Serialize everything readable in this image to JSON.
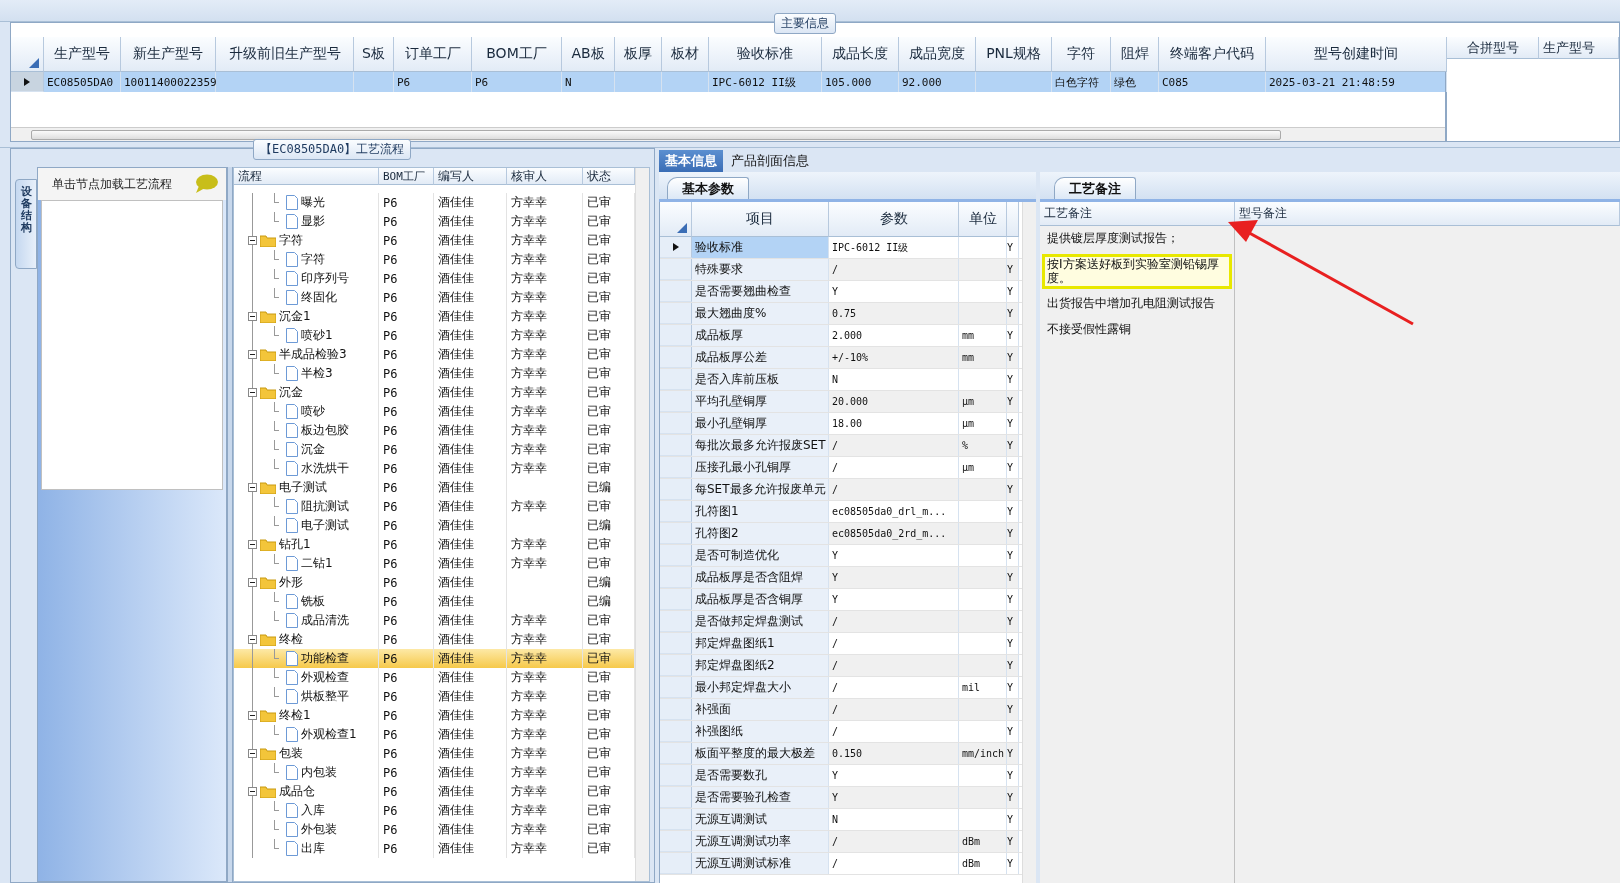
{
  "main_info": {
    "title": "主要信息",
    "columns": [
      "生产型号",
      "新生产型号",
      "升级前旧生产型号",
      "S板",
      "订单工厂",
      "BOM工厂",
      "AB板",
      "板厚",
      "板材",
      "验收标准",
      "成品长度",
      "成品宽度",
      "PNL规格",
      "字符",
      "阻焊",
      "终端客户代码",
      "型号创建时间"
    ],
    "rows": [
      {
        "selected": true,
        "cells": [
          "EC08505DA0",
          "10011400022359",
          null,
          null,
          "P6",
          "P6",
          "N",
          null,
          null,
          "IPC-6012 II级",
          "105.000",
          "92.000",
          null,
          "白色字符",
          "绿色",
          "C085",
          "2025-03-21 21:48:59"
        ]
      }
    ]
  },
  "merge_grid": {
    "columns": [
      "合拼型号",
      "生产型号"
    ]
  },
  "process_flow": {
    "title": "【EC08505DA0】工艺流程",
    "side_tab": "设备结构",
    "hint": "单击节点加载工艺流程",
    "columns": [
      "流程",
      "BOM工厂",
      "编写人",
      "核审人",
      "状态"
    ],
    "tree": [
      {
        "children": [
          {
            "label": "曝光",
            "bom": "P6",
            "writer": "酒佳佳",
            "reviewer": "方幸幸",
            "status": "已审",
            "selected": false
          },
          {
            "label": "显影",
            "bom": "P6",
            "writer": "酒佳佳",
            "reviewer": "方幸幸",
            "status": "已审",
            "selected": false
          }
        ]
      },
      {
        "label": "字符",
        "bom": "P6",
        "writer": "酒佳佳",
        "reviewer": "方幸幸",
        "status": "已审",
        "expanded": true,
        "selected": false,
        "children": [
          {
            "label": "字符",
            "bom": "P6",
            "writer": "酒佳佳",
            "reviewer": "方幸幸",
            "status": "已审",
            "selected": false
          },
          {
            "label": "印序列号",
            "bom": "P6",
            "writer": "酒佳佳",
            "reviewer": "方幸幸",
            "status": "已审",
            "selected": false
          },
          {
            "label": "终固化",
            "bom": "P6",
            "writer": "酒佳佳",
            "reviewer": "方幸幸",
            "status": "已审",
            "selected": false
          }
        ]
      },
      {
        "label": "沉金1",
        "bom": "P6",
        "writer": "酒佳佳",
        "reviewer": "方幸幸",
        "status": "已审",
        "expanded": true,
        "selected": false,
        "children": [
          {
            "label": "喷砂1",
            "bom": "P6",
            "writer": "酒佳佳",
            "reviewer": "方幸幸",
            "status": "已审",
            "selected": false
          }
        ]
      },
      {
        "label": "半成品检验3",
        "bom": "P6",
        "writer": "酒佳佳",
        "reviewer": "方幸幸",
        "status": "已审",
        "expanded": true,
        "selected": false,
        "children": [
          {
            "label": "半检3",
            "bom": "P6",
            "writer": "酒佳佳",
            "reviewer": "方幸幸",
            "status": "已审",
            "selected": false
          }
        ]
      },
      {
        "label": "沉金",
        "bom": "P6",
        "writer": "酒佳佳",
        "reviewer": "方幸幸",
        "status": "已审",
        "expanded": true,
        "selected": false,
        "children": [
          {
            "label": "喷砂",
            "bom": "P6",
            "writer": "酒佳佳",
            "reviewer": "方幸幸",
            "status": "已审",
            "selected": false
          },
          {
            "label": "板边包胶",
            "bom": "P6",
            "writer": "酒佳佳",
            "reviewer": "方幸幸",
            "status": "已审",
            "selected": false
          },
          {
            "label": "沉金",
            "bom": "P6",
            "writer": "酒佳佳",
            "reviewer": "方幸幸",
            "status": "已审",
            "selected": false
          },
          {
            "label": "水洗烘干",
            "bom": "P6",
            "writer": "酒佳佳",
            "reviewer": "方幸幸",
            "status": "已审",
            "selected": false
          }
        ]
      },
      {
        "label": "电子测试",
        "bom": "P6",
        "writer": "酒佳佳",
        "status": "已编",
        "expanded": true,
        "selected": false,
        "children": [
          {
            "label": "阻抗测试",
            "bom": "P6",
            "writer": "酒佳佳",
            "reviewer": "方幸幸",
            "status": "已审",
            "selected": false
          },
          {
            "label": "电子测试",
            "bom": "P6",
            "writer": "酒佳佳",
            "status": "已编",
            "selected": false
          }
        ]
      },
      {
        "label": "钻孔1",
        "bom": "P6",
        "writer": "酒佳佳",
        "reviewer": "方幸幸",
        "status": "已审",
        "expanded": true,
        "selected": false,
        "children": [
          {
            "label": "二钻1",
            "bom": "P6",
            "writer": "酒佳佳",
            "reviewer": "方幸幸",
            "status": "已审",
            "selected": false
          }
        ]
      },
      {
        "label": "外形",
        "bom": "P6",
        "writer": "酒佳佳",
        "status": "已编",
        "expanded": true,
        "selected": false,
        "children": [
          {
            "label": "铣板",
            "bom": "P6",
            "writer": "酒佳佳",
            "status": "已编",
            "selected": false
          },
          {
            "label": "成品清洗",
            "bom": "P6",
            "writer": "酒佳佳",
            "reviewer": "方幸幸",
            "status": "已审",
            "selected": false
          }
        ]
      },
      {
        "label": "终检",
        "bom": "P6",
        "writer": "酒佳佳",
        "reviewer": "方幸幸",
        "status": "已审",
        "expanded": true,
        "selected": false,
        "children": [
          {
            "label": "功能检查",
            "bom": "P6",
            "writer": "酒佳佳",
            "reviewer": "方幸幸",
            "status": "已审",
            "selected": true
          },
          {
            "label": "外观检查",
            "bom": "P6",
            "writer": "酒佳佳",
            "reviewer": "方幸幸",
            "status": "已审",
            "selected": false
          },
          {
            "label": "烘板整平",
            "bom": "P6",
            "writer": "酒佳佳",
            "reviewer": "方幸幸",
            "status": "已审",
            "selected": false
          }
        ]
      },
      {
        "label": "终检1",
        "bom": "P6",
        "writer": "酒佳佳",
        "reviewer": "方幸幸",
        "status": "已审",
        "expanded": true,
        "selected": false,
        "children": [
          {
            "label": "外观检查1",
            "bom": "P6",
            "writer": "酒佳佳",
            "reviewer": "方幸幸",
            "status": "已审",
            "selected": false
          }
        ]
      },
      {
        "label": "包装",
        "bom": "P6",
        "writer": "酒佳佳",
        "reviewer": "方幸幸",
        "status": "已审",
        "expanded": true,
        "selected": false,
        "children": [
          {
            "label": "内包装",
            "bom": "P6",
            "writer": "酒佳佳",
            "reviewer": "方幸幸",
            "status": "已审",
            "selected": false
          }
        ]
      },
      {
        "label": "成品仓",
        "bom": "P6",
        "writer": "酒佳佳",
        "reviewer": "方幸幸",
        "status": "已审",
        "expanded": true,
        "selected": false,
        "children": [
          {
            "label": "入库",
            "bom": "P6",
            "writer": "酒佳佳",
            "reviewer": "方幸幸",
            "status": "已审",
            "selected": false
          },
          {
            "label": "外包装",
            "bom": "P6",
            "writer": "酒佳佳",
            "reviewer": "方幸幸",
            "status": "已审",
            "selected": false
          },
          {
            "label": "出库",
            "bom": "P6",
            "writer": "酒佳佳",
            "reviewer": "方幸幸",
            "status": "已审",
            "selected": false
          }
        ]
      }
    ]
  },
  "info_tabs": [
    {
      "label": "基本信息",
      "selected": true
    },
    {
      "label": "产品剖面信息",
      "selected": false
    }
  ],
  "params": {
    "tab": "基本参数",
    "columns": [
      "项目",
      "参数",
      "单位"
    ],
    "rows": [
      {
        "item": "验收标准",
        "value": "IPC-6012 II级",
        "column_4": "Y",
        "selected": true
      },
      {
        "item": "特殊要求",
        "value": "/",
        "column_4": "Y",
        "selected": false
      },
      {
        "item": "是否需要翘曲检查",
        "value": "Y",
        "column_4": "Y",
        "selected": false
      },
      {
        "item": "最大翘曲度%",
        "value": "0.75",
        "column_4": "Y",
        "selected": false
      },
      {
        "item": "成品板厚",
        "value": "2.000",
        "unit": "mm",
        "column_4": "Y",
        "selected": false
      },
      {
        "item": "成品板厚公差",
        "value": "+/-10%",
        "unit": "mm",
        "column_4": "Y",
        "selected": false
      },
      {
        "item": "是否入库前压板",
        "value": "N",
        "column_4": "Y",
        "selected": false
      },
      {
        "item": "平均孔壁铜厚",
        "value": "20.000",
        "unit": "μm",
        "column_4": "Y",
        "selected": false
      },
      {
        "item": "最小孔壁铜厚",
        "value": "18.00",
        "unit": "μm",
        "column_4": "Y",
        "selected": false
      },
      {
        "item": "每批次最多允许报废SET",
        "value": "/",
        "unit": "%",
        "column_4": "Y",
        "selected": false
      },
      {
        "item": "压接孔最小孔铜厚",
        "value": "/",
        "unit": "μm",
        "column_4": "Y",
        "selected": false
      },
      {
        "item": "每SET最多允许报废单元",
        "value": "/",
        "column_4": "Y",
        "selected": false
      },
      {
        "item": "孔符图1",
        "value": "ec08505da0_drl_m...",
        "column_4": "Y",
        "selected": false
      },
      {
        "item": "孔符图2",
        "value": "ec08505da0_2rd_m...",
        "column_4": "Y",
        "selected": false
      },
      {
        "item": "是否可制造优化",
        "value": "Y",
        "column_4": "Y",
        "selected": false
      },
      {
        "item": "成品板厚是否含阻焊",
        "value": "Y",
        "column_4": "Y",
        "selected": false
      },
      {
        "item": "成品板厚是否含铜厚",
        "value": "Y",
        "column_4": "Y",
        "selected": false
      },
      {
        "item": "是否做邦定焊盘测试",
        "value": "/",
        "column_4": "Y",
        "selected": false
      },
      {
        "item": "邦定焊盘图纸1",
        "value": "/",
        "column_4": "Y",
        "selected": false
      },
      {
        "item": "邦定焊盘图纸2",
        "value": "/",
        "column_4": "Y",
        "selected": false
      },
      {
        "item": "最小邦定焊盘大小",
        "value": "/",
        "unit": "mil",
        "column_4": "Y",
        "selected": false
      },
      {
        "item": "补强面",
        "value": "/",
        "column_4": "Y",
        "selected": false
      },
      {
        "item": "补强图纸",
        "value": "/",
        "column_4": "Y",
        "selected": false
      },
      {
        "item": "板面平整度的最大极差",
        "value": "0.150",
        "unit": "mm/inch",
        "column_4": "Y",
        "selected": false
      },
      {
        "item": "是否需要数孔",
        "value": "Y",
        "column_4": "Y",
        "selected": false
      },
      {
        "item": "是否需要验孔检查",
        "value": "Y",
        "column_4": "Y",
        "selected": false
      },
      {
        "item": "无源互调测试",
        "value": "N",
        "column_4": "Y",
        "selected": false
      },
      {
        "item": "无源互调测试功率",
        "value": "/",
        "unit": "dBm",
        "column_4": "Y",
        "selected": false
      },
      {
        "item": "无源互调测试标准",
        "value": "/",
        "unit": "dBm",
        "column_4": "Y",
        "selected": false
      }
    ]
  },
  "remarks": {
    "tab": "工艺备注",
    "columns": [
      "工艺备注",
      "型号备注"
    ],
    "notes": [
      {
        "text": "提供镀层厚度测试报告；",
        "highlighted": false
      },
      {
        "text": "按I方案送好板到实验室测铅锡厚度。",
        "highlighted": true
      },
      {
        "text": "出货报告中增加孔电阻测试报告",
        "highlighted": false
      },
      {
        "text": "不接受假性露铜",
        "highlighted": false
      }
    ]
  }
}
